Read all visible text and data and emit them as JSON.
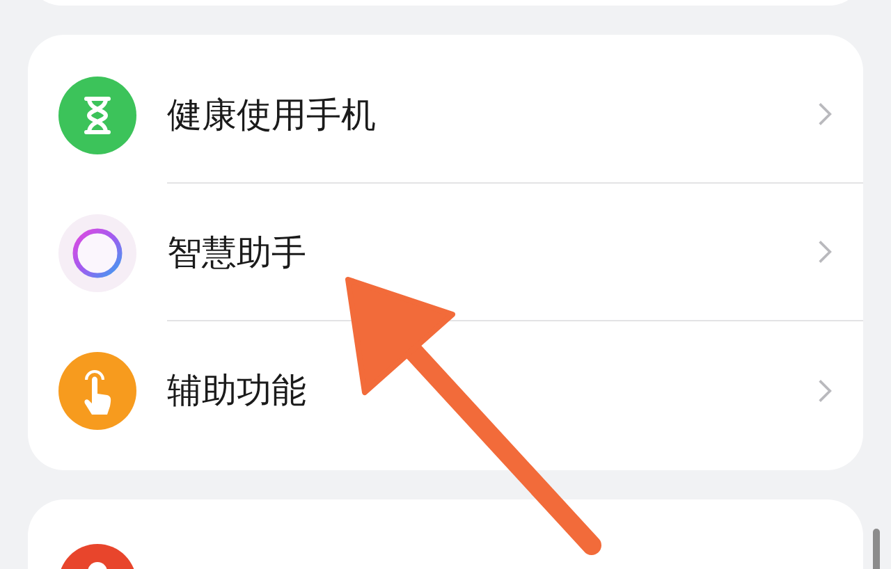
{
  "settings_group": [
    {
      "label": "健康使用手机"
    },
    {
      "label": "智慧助手"
    },
    {
      "label": "辅助功能"
    }
  ]
}
